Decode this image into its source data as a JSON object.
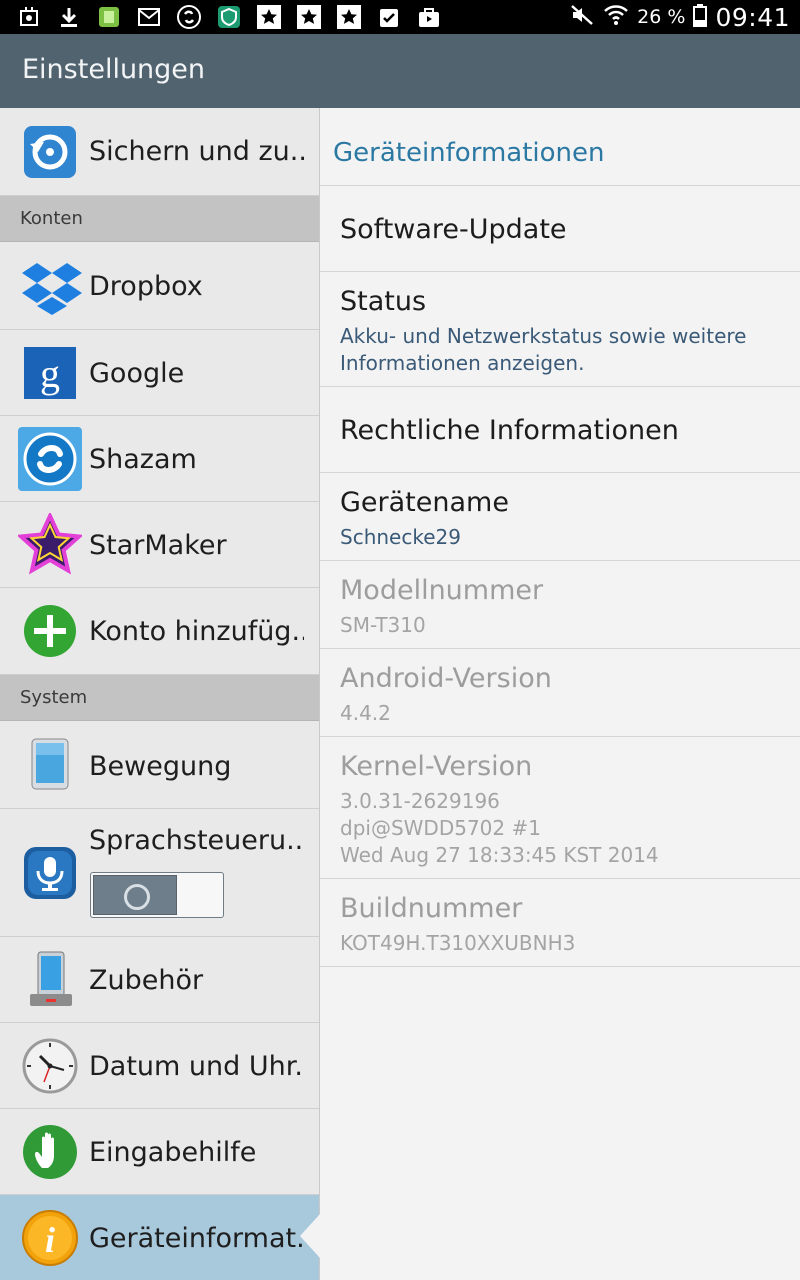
{
  "status_bar": {
    "battery_percent": "26 %",
    "time": "09:41",
    "icons": [
      "cpu-icon",
      "download-icon",
      "apk-icon",
      "gmail-icon",
      "shazam-icon",
      "shield-icon",
      "star-icon",
      "star-icon",
      "star-icon",
      "clipboard-check-icon",
      "shopping-bag-icon",
      "mute-icon",
      "wifi-icon",
      "battery-icon"
    ]
  },
  "action_bar": {
    "title": "Einstellungen"
  },
  "left_menu": {
    "item_backup": "Sichern und zu..",
    "header_accounts": "Konten",
    "item_dropbox": "Dropbox",
    "item_google": "Google",
    "item_shazam": "Shazam",
    "item_starmaker": "StarMaker",
    "item_add_account": "Konto hinzufüg..",
    "header_system": "System",
    "item_motion": "Bewegung",
    "item_voice": "Sprachsteueru..",
    "item_accessories": "Zubehör",
    "item_datetime": "Datum und Uhr..",
    "item_accessibility": "Eingabehilfe",
    "item_device_info": "Geräteinformat.."
  },
  "detail": {
    "title": "Geräteinformationen",
    "software_update": "Software-Update",
    "status_title": "Status",
    "status_sub_1": "Akku- und Netzwerkstatus sowie weitere",
    "status_sub_2": "Informationen anzeigen.",
    "legal": "Rechtliche Informationen",
    "device_name_title": "Gerätename",
    "device_name_value": "Schnecke29",
    "model_title": "Modellnummer",
    "model_value": "SM-T310",
    "android_title": "Android-Version",
    "android_value": "4.4.2",
    "kernel_title": "Kernel-Version",
    "kernel_value_1": "3.0.31-2629196",
    "kernel_value_2": "dpi@SWDD5702 #1",
    "kernel_value_3": "Wed Aug 27 18:33:45 KST 2014",
    "build_title": "Buildnummer",
    "build_value": "KOT49H.T310XXUBNH3"
  },
  "colors": {
    "action_bar": "#51636f",
    "accent_text": "#2b79a3",
    "selected_item": "#a8c8dc"
  }
}
